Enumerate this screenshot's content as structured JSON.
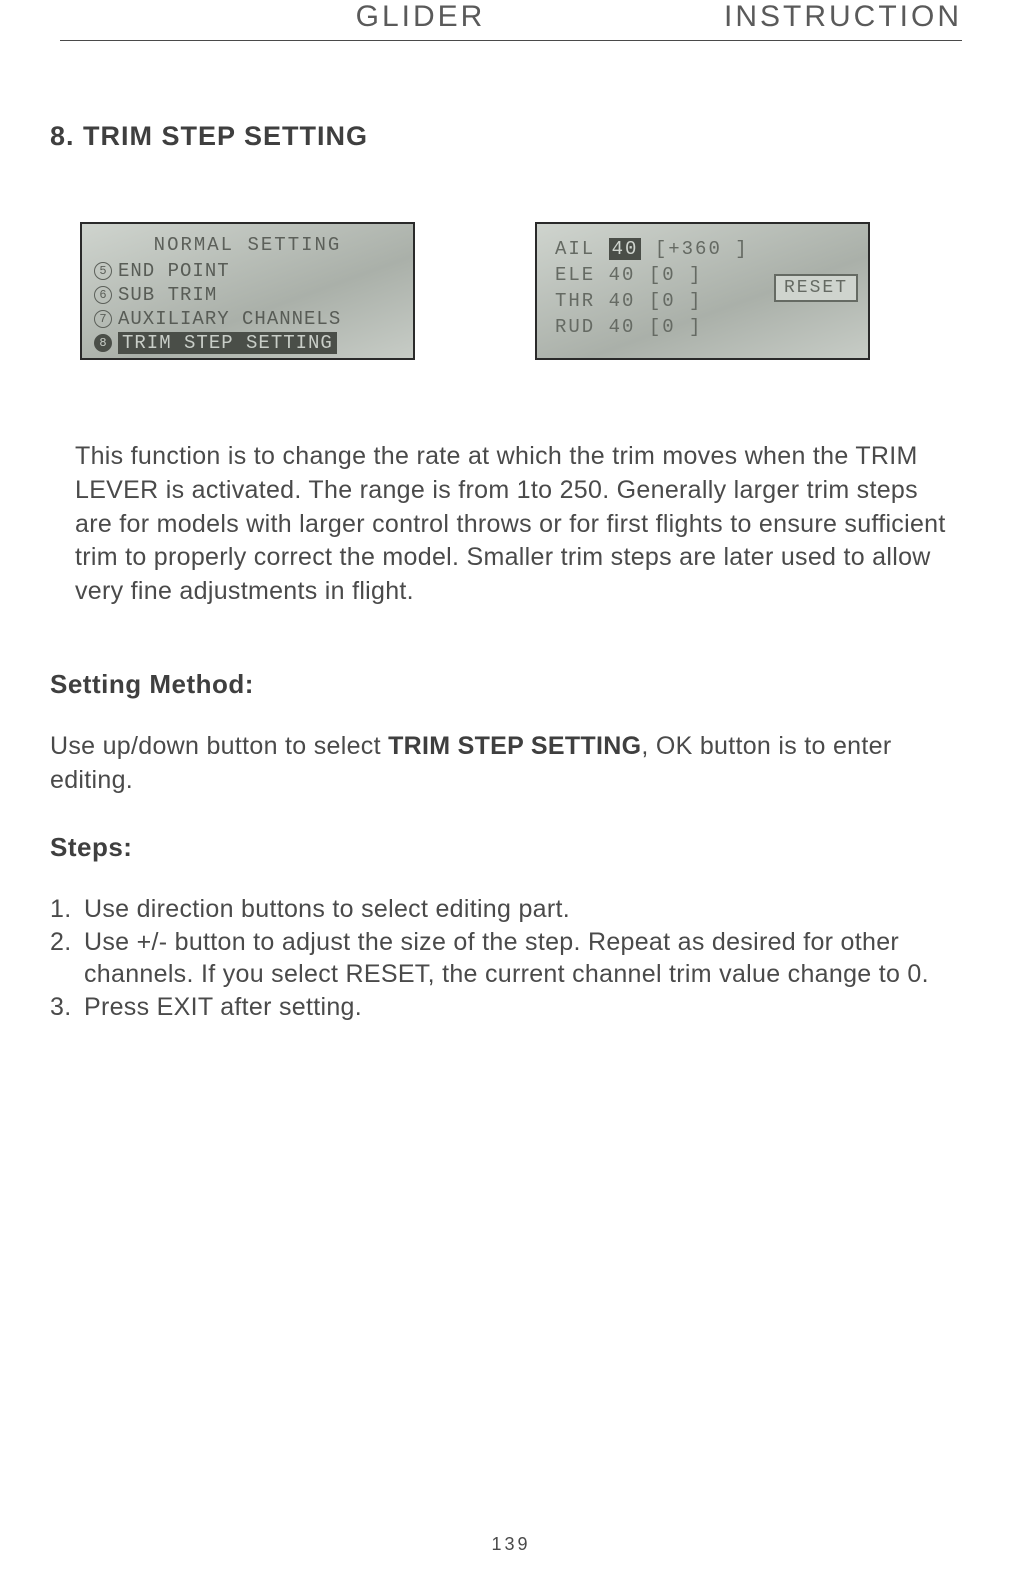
{
  "header": {
    "left": "GLIDER",
    "right": "INSTRUCTION"
  },
  "section_title": "8. TRIM STEP SETTING",
  "lcd1": {
    "title": "NORMAL SETTING",
    "items": [
      {
        "num": "5",
        "label": "END POINT",
        "selected": false
      },
      {
        "num": "6",
        "label": "SUB TRIM",
        "selected": false
      },
      {
        "num": "7",
        "label": "AUXILIARY CHANNELS",
        "selected": false
      },
      {
        "num": "8",
        "label": "TRIM STEP SETTING",
        "selected": true
      }
    ]
  },
  "lcd2": {
    "rows": [
      {
        "ch": "AIL",
        "val": "40",
        "bracket": "[+360 ]",
        "highlight": true
      },
      {
        "ch": "ELE",
        "val": "40",
        "bracket": "[0    ]",
        "highlight": false
      },
      {
        "ch": "THR",
        "val": "40",
        "bracket": "[0    ]",
        "highlight": false
      },
      {
        "ch": "RUD",
        "val": "40",
        "bracket": "[0    ]",
        "highlight": false
      }
    ],
    "reset": "RESET"
  },
  "intro": "This function is to change the rate at which the trim moves when the TRIM LEVER is activated.  The range is from 1to 250. Generally larger trim steps are for models with larger control throws or for first flights to ensure sufficient trim to properly correct the model. Smaller trim steps are later used to allow very fine adjustments in flight.",
  "setting_method_heading": "Setting Method:",
  "setting_method_pre": "Use up/down button to select ",
  "setting_method_bold": "TRIM STEP SETTING",
  "setting_method_post": ", OK button is to enter editing.",
  "steps_heading": "Steps:",
  "steps": [
    "Use direction buttons to select editing part.",
    "Use +/- button to adjust the size of the step. Repeat as desired for other channels. If you select RESET, the current channel trim value change to 0.",
    "Press EXIT after setting."
  ],
  "page_number": "139"
}
